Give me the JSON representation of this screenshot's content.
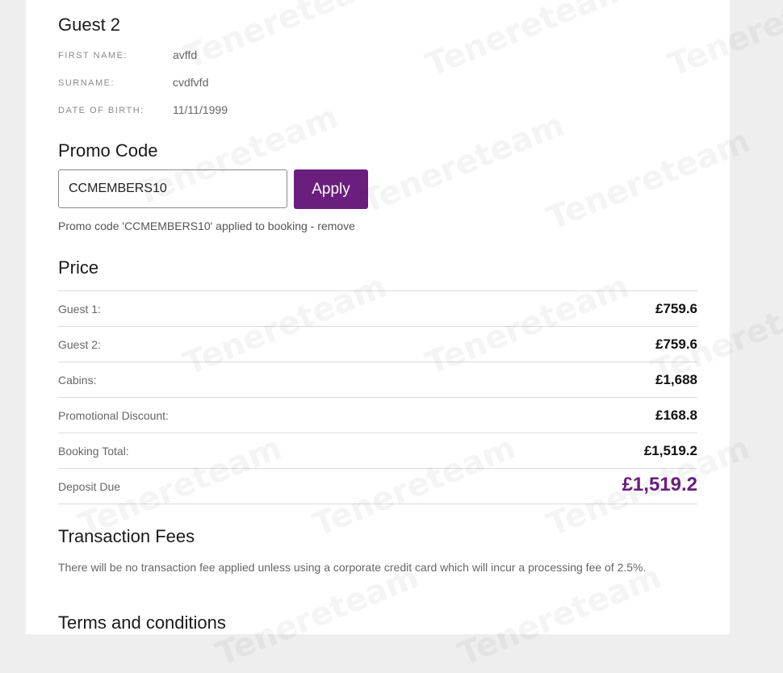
{
  "guest2": {
    "heading": "Guest 2",
    "fields": [
      {
        "label": "FIRST NAME:",
        "value": "avffd"
      },
      {
        "label": "SURNAME:",
        "value": "cvdfvfd"
      },
      {
        "label": "DATE OF BIRTH:",
        "value": "11/11/1999"
      }
    ]
  },
  "promo": {
    "heading": "Promo Code",
    "input_value": "CCMEMBERS10",
    "apply_label": "Apply",
    "message": "Promo code 'CCMEMBERS10' applied to booking - ",
    "remove_label": "remove"
  },
  "price": {
    "heading": "Price",
    "rows": [
      {
        "label": "Guest 1:",
        "amount": "£759.6"
      },
      {
        "label": "Guest 2:",
        "amount": "£759.6"
      },
      {
        "label": "Cabins:",
        "amount": "£1,688"
      },
      {
        "label": "Promotional Discount:",
        "amount": "£168.8"
      },
      {
        "label": "Booking Total:",
        "amount": "£1,519.2"
      },
      {
        "label": "Deposit Due",
        "amount": "£1,519.2"
      }
    ]
  },
  "fees": {
    "heading": "Transaction Fees",
    "text": "There will be no transaction fee applied unless using a corporate credit card which will incur a processing fee of 2.5%."
  },
  "terms": {
    "heading": "Terms and conditions"
  },
  "watermark": "Tenereteam",
  "colors": {
    "accent": "#6a1f7e",
    "background": "#eeeeee"
  }
}
